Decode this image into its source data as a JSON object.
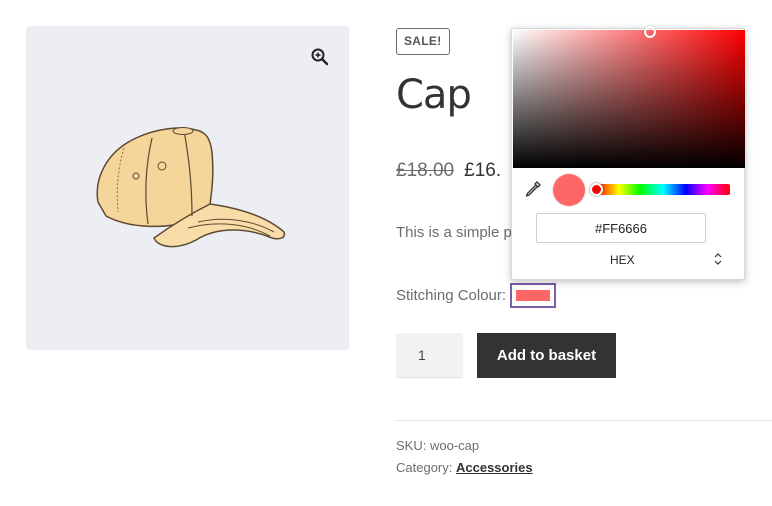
{
  "product": {
    "sale_badge": "SALE!",
    "title": "Cap",
    "price_old": "£18.00",
    "price_new": "£16.",
    "description": "This is a simple pr",
    "stitch_label": "Stitching Colour:",
    "quantity": "1",
    "add_to_basket": "Add to basket",
    "sku_label": "SKU: woo-cap",
    "category_prefix": "Category: ",
    "category_link": "Accessories"
  },
  "picker": {
    "hex_value": "#FF6666",
    "format": "HEX",
    "format_arrows": "⌃⌄",
    "hue_color": "#ff0000",
    "selected_color": "#ff6666"
  },
  "icons": {
    "zoom": "magnifier-plus-icon",
    "eyedropper": "eyedropper-icon",
    "updown": "chevron-updown-icon"
  },
  "colors": {
    "button_dark": "#333333",
    "swatch_border": "#7b5ea7",
    "gallery_bg": "#eceef3"
  }
}
